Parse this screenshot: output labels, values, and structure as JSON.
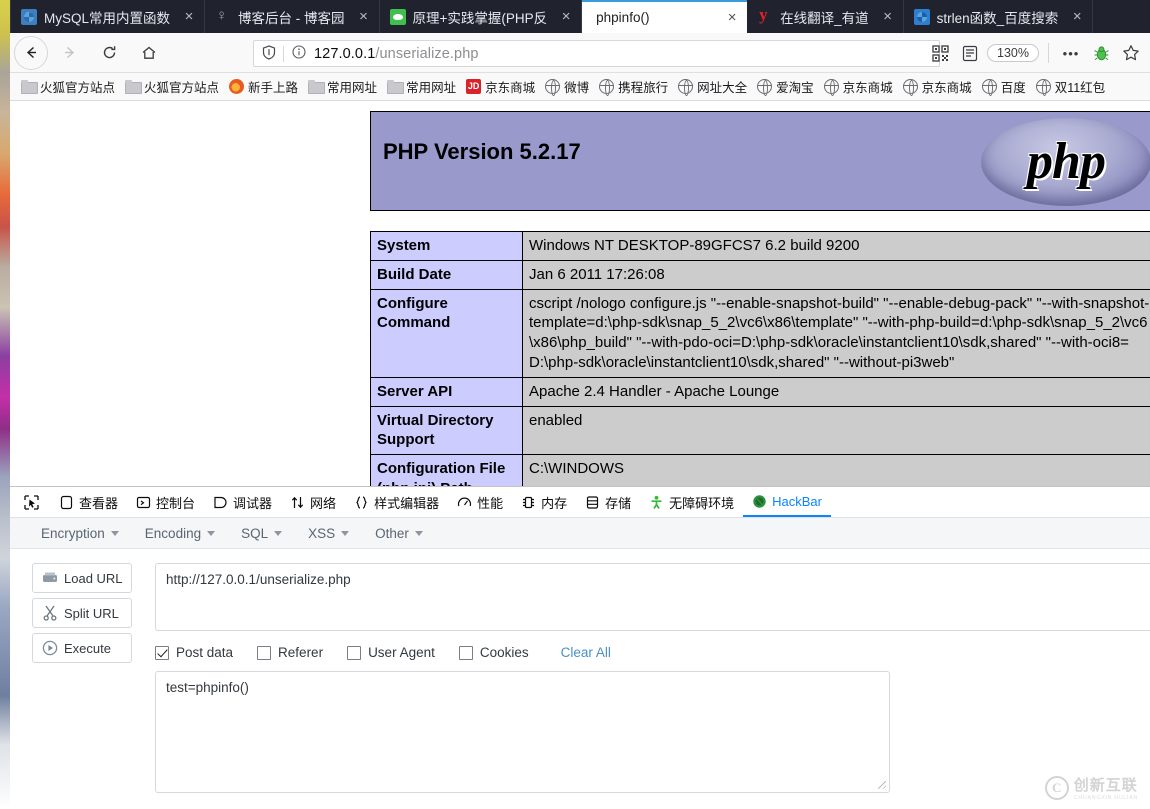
{
  "browser": {
    "tabs": [
      {
        "title": "MySQL常用内置函数",
        "favicon": "mysql-icon",
        "active": false
      },
      {
        "title": "博客后台 - 博客园",
        "favicon": "cnblogs-icon",
        "active": false
      },
      {
        "title": "原理+实践掌握(PHP反",
        "favicon": "wechat-icon",
        "active": false
      },
      {
        "title": "phpinfo()",
        "favicon": "none",
        "active": true
      },
      {
        "title": "在线翻译_有道",
        "favicon": "youdao-icon",
        "active": false
      },
      {
        "title": "strlen函数_百度搜索",
        "favicon": "baidu-icon",
        "active": false
      }
    ],
    "tab_close_label": "×",
    "nav": {
      "back_icon": "←",
      "forward_icon": "→",
      "reload_icon": "⟳",
      "home_icon": "⌂"
    },
    "urlbar": {
      "shield_icon": "shield-icon",
      "info_icon": "ⓘ",
      "url_host": "127.0.0.1",
      "url_path": "/unserialize.php"
    },
    "toolbar_right": {
      "qrcode_icon": "qr-code-icon",
      "reader_icon": "reader-mode-icon",
      "zoom_level": "130%",
      "more_icon": "•••",
      "bug_icon": "bug-icon",
      "bookmark_icon": "☆"
    },
    "bookmarks": [
      {
        "label": "火狐官方站点",
        "icon": "folder-icon"
      },
      {
        "label": "火狐官方站点",
        "icon": "folder-icon"
      },
      {
        "label": "新手上路",
        "icon": "firefox-icon"
      },
      {
        "label": "常用网址",
        "icon": "folder-icon"
      },
      {
        "label": "常用网址",
        "icon": "folder-icon"
      },
      {
        "label": "京东商城",
        "icon": "jd-icon"
      },
      {
        "label": "微博",
        "icon": "globe-icon"
      },
      {
        "label": "携程旅行",
        "icon": "globe-icon"
      },
      {
        "label": "网址大全",
        "icon": "globe-icon"
      },
      {
        "label": "爱淘宝",
        "icon": "globe-icon"
      },
      {
        "label": "京东商城",
        "icon": "globe-icon"
      },
      {
        "label": "京东商城",
        "icon": "globe-icon"
      },
      {
        "label": "百度",
        "icon": "globe-icon"
      },
      {
        "label": "双11红包",
        "icon": "globe-icon"
      }
    ]
  },
  "phpinfo": {
    "version_heading": "PHP Version 5.2.17",
    "logo_text": "php",
    "rows": [
      {
        "key": "System",
        "value": "Windows NT DESKTOP-89GFCS7 6.2 build 9200"
      },
      {
        "key": "Build Date",
        "value": "Jan 6 2011 17:26:08"
      },
      {
        "key": "Configure Command",
        "value": "cscript /nologo configure.js \"--enable-snapshot-build\" \"--enable-debug-pack\" \"--with-snapshot-template=d:\\php-sdk\\snap_5_2\\vc6\\x86\\template\" \"--with-php-build=d:\\php-sdk\\snap_5_2\\vc6\\x86\\php_build\" \"--with-pdo-oci=D:\\php-sdk\\oracle\\instantclient10\\sdk,shared\" \"--with-oci8=D:\\php-sdk\\oracle\\instantclient10\\sdk,shared\" \"--without-pi3web\""
      },
      {
        "key": "Server API",
        "value": "Apache 2.4 Handler - Apache Lounge"
      },
      {
        "key": "Virtual Directory Support",
        "value": "enabled"
      },
      {
        "key": "Configuration File (php.ini) Path",
        "value": "C:\\WINDOWS"
      }
    ]
  },
  "devtools": {
    "picker_icon": "element-picker-icon",
    "tabs": [
      {
        "label": "查看器",
        "icon": "inspector-icon",
        "selected": false
      },
      {
        "label": "控制台",
        "icon": "console-icon",
        "selected": false
      },
      {
        "label": "调试器",
        "icon": "debugger-icon",
        "selected": false
      },
      {
        "label": "网络",
        "icon": "network-icon",
        "selected": false
      },
      {
        "label": "样式编辑器",
        "icon": "style-editor-icon",
        "selected": false
      },
      {
        "label": "性能",
        "icon": "performance-icon",
        "selected": false
      },
      {
        "label": "内存",
        "icon": "memory-icon",
        "selected": false
      },
      {
        "label": "存储",
        "icon": "storage-icon",
        "selected": false
      },
      {
        "label": "无障碍环境",
        "icon": "accessibility-icon",
        "selected": false
      },
      {
        "label": "HackBar",
        "icon": "hackbar-icon",
        "selected": true
      }
    ]
  },
  "hackbar": {
    "menus": [
      {
        "label": "Encryption"
      },
      {
        "label": "Encoding"
      },
      {
        "label": "SQL"
      },
      {
        "label": "XSS"
      },
      {
        "label": "Other"
      }
    ],
    "buttons": [
      {
        "label": "Load URL",
        "icon": "load-url-icon"
      },
      {
        "label": "Split URL",
        "icon": "split-url-icon"
      },
      {
        "label": "Execute",
        "icon": "execute-icon"
      }
    ],
    "url_value": "http://127.0.0.1/unserialize.php",
    "url_placeholder": "",
    "checkboxes": [
      {
        "label": "Post data",
        "checked": true
      },
      {
        "label": "Referer",
        "checked": false
      },
      {
        "label": "User Agent",
        "checked": false
      },
      {
        "label": "Cookies",
        "checked": false
      }
    ],
    "clear_all_label": "Clear All",
    "post_data_value": "test=phpinfo()",
    "post_data_placeholder": ""
  },
  "watermark": {
    "mark": "C",
    "text": "创新互联",
    "subtext": "CHUANGXIN HULIAN"
  }
}
